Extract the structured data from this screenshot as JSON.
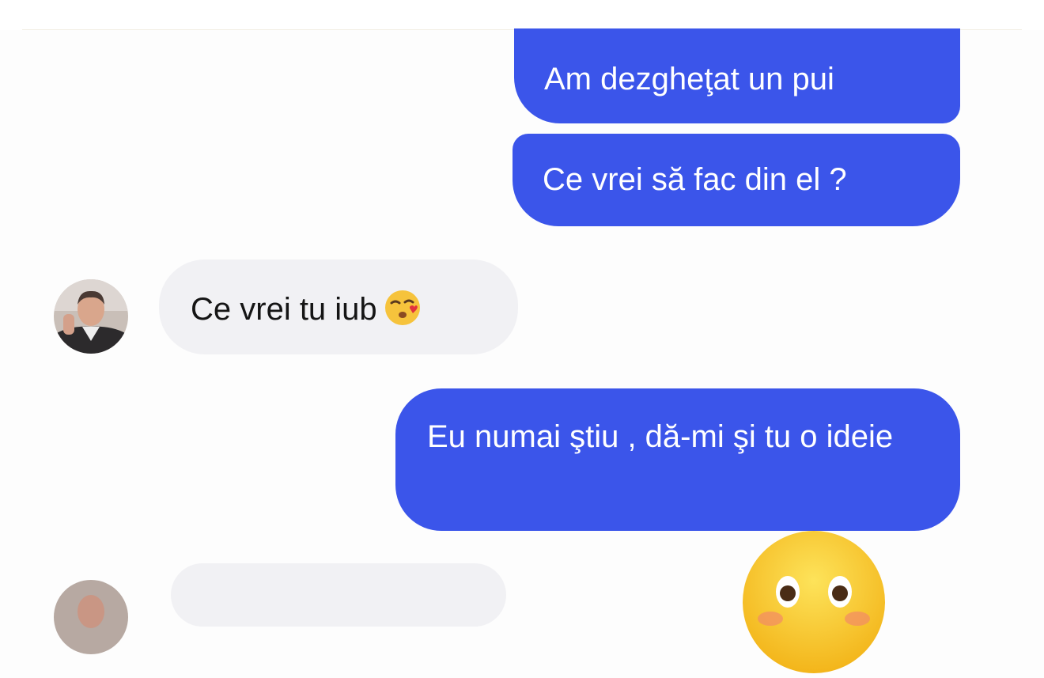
{
  "conversation": {
    "messages": [
      {
        "direction": "outgoing",
        "text": "Am dezgheţat un pui"
      },
      {
        "direction": "outgoing",
        "text": "Ce vrei să fac din el ?"
      },
      {
        "direction": "incoming",
        "text": "Ce vrei tu iub",
        "emoji": "kissing-face-emoji"
      },
      {
        "direction": "outgoing",
        "text": "Eu numai ştiu , dă-mi şi tu o ideie"
      },
      {
        "direction": "incoming",
        "text": ""
      }
    ],
    "reaction_emoji": "flushed-face-emoji"
  },
  "colors": {
    "outgoing_bubble": "#3b55ea",
    "incoming_bubble": "#f1f1f4",
    "background": "#fdfdfd"
  }
}
